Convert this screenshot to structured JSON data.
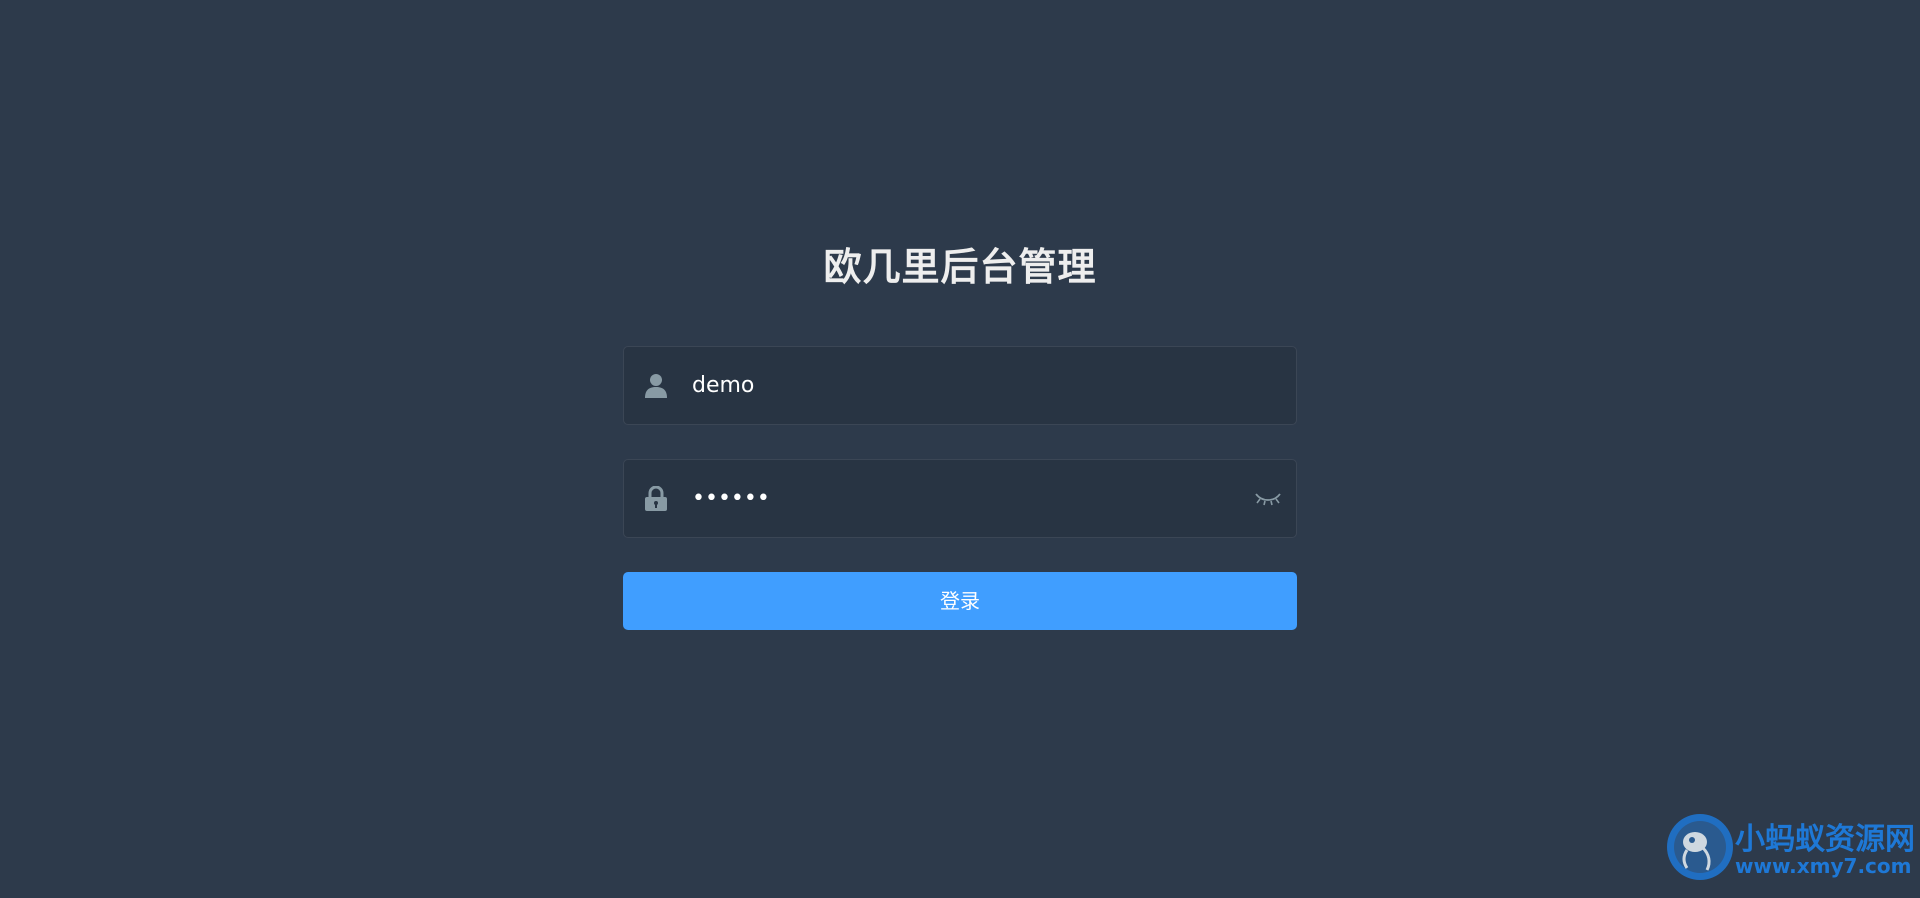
{
  "page": {
    "title": "欧几里后台管理"
  },
  "login_form": {
    "username": {
      "value": "demo",
      "icon": "user-icon"
    },
    "password": {
      "value": "••••••",
      "icon": "lock-icon",
      "toggle_icon": "eye-closed-icon"
    },
    "submit_label": "登录"
  },
  "watermark": {
    "name": "小蚂蚁资源网",
    "url": "www.xmy7.com"
  },
  "colors": {
    "background": "#2d3a4b",
    "input_background": "#283443",
    "button": "#409eff",
    "watermark": "#1e78d6"
  }
}
